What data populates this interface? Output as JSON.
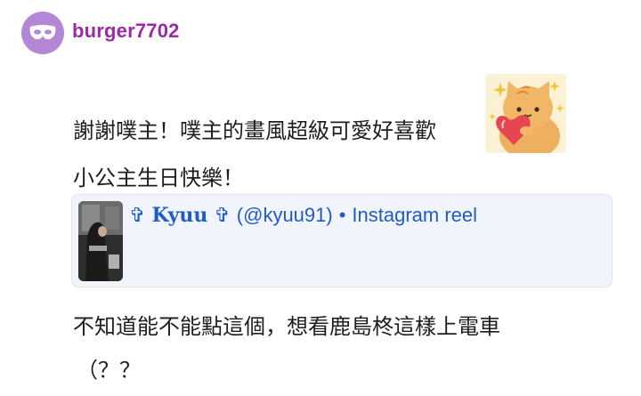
{
  "post": {
    "username": "burger7702",
    "lines": [
      "謝謝噗主！噗主的畫風超級可愛好喜歡",
      "小公主生日快樂！",
      "不知道能不能點這個，想看鹿島柊這樣上電車",
      "（？？"
    ]
  },
  "embed": {
    "cross_left": "✞",
    "name": "Kyuu",
    "cross_right": "✞",
    "handle": "(@kyuu91)",
    "separator": "•",
    "type": "Instagram reel"
  },
  "colors": {
    "username": "#9b2aa8",
    "avatar": "#b487d6",
    "link": "#1f5cc7",
    "embed_bg": "#f1f4fb"
  },
  "icons": {
    "avatar": "mask-icon",
    "sticker": "cat-holding-heart-sticker"
  }
}
